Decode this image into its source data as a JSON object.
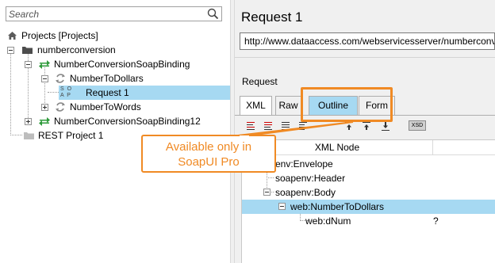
{
  "search": {
    "placeholder": "Search"
  },
  "tree": {
    "root": "Projects [Projects]",
    "items": [
      {
        "label": "numberconversion"
      },
      {
        "label": "NumberConversionSoapBinding"
      },
      {
        "label": "NumberToDollars"
      },
      {
        "label": "Request 1",
        "badge_top": "S O",
        "badge_bottom": "A P"
      },
      {
        "label": "NumberToWords"
      },
      {
        "label": "NumberConversionSoapBinding12"
      },
      {
        "label": "REST Project 1"
      }
    ]
  },
  "request": {
    "title": "Request 1",
    "url": "http://www.dataaccess.com/webservicesserver/numberconversion.wso",
    "section_label": "Request",
    "tabs": [
      "XML",
      "Raw",
      "Outline",
      "Form"
    ],
    "active_tab": "Outline"
  },
  "toolbar": {
    "xsd_label": "XSD"
  },
  "outline": {
    "column_header": "XML Node",
    "rows": [
      {
        "node": "env:Envelope",
        "value": ""
      },
      {
        "node": "soapenv:Header",
        "value": ""
      },
      {
        "node": "soapenv:Body",
        "value": ""
      },
      {
        "node": "web:NumberToDollars",
        "value": ""
      },
      {
        "node": "web:dNum",
        "value": "?"
      }
    ]
  },
  "callout": {
    "line1": "Available only in",
    "line2": "SoapUI Pro"
  },
  "colors": {
    "accent": "#f08a24",
    "selection": "#a6d9f2",
    "green_arrows": "#2e9a3a"
  }
}
